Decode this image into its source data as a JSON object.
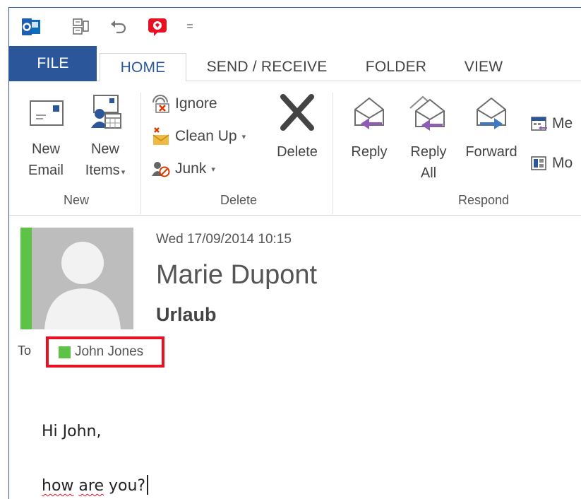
{
  "qat": {
    "icons": [
      "outlook-app-icon",
      "address-book-icon",
      "undo-icon",
      "add-in-icon",
      "customize-qat-icon"
    ],
    "customize_glyph": "="
  },
  "tabs": [
    {
      "label": "FILE"
    },
    {
      "label": "HOME"
    },
    {
      "label": "SEND / RECEIVE"
    },
    {
      "label": "FOLDER"
    },
    {
      "label": "VIEW"
    }
  ],
  "ribbon": {
    "new_group": {
      "label": "New",
      "new_email": {
        "line1": "New",
        "line2": "Email"
      },
      "new_items": {
        "line1": "New",
        "line2": "Items"
      }
    },
    "delete_group": {
      "label": "Delete",
      "ignore": "Ignore",
      "cleanup": "Clean Up",
      "junk": "Junk",
      "delete": "Delete"
    },
    "respond_group": {
      "label": "Respond",
      "reply": "Reply",
      "reply_all": {
        "line1": "Reply",
        "line2": "All"
      },
      "forward": "Forward",
      "meeting": "Me",
      "more": "Mo"
    }
  },
  "message": {
    "date": "Wed 17/09/2014 10:15",
    "sender": "Marie Dupont",
    "subject": "Urlaub",
    "to_label": "To",
    "recipient": "John Jones",
    "body_line1": "Hi John,",
    "body_line2_word1": "how",
    "body_line2_word2": "are",
    "body_line2_word3": "you?"
  },
  "colors": {
    "accent": "#2b579a",
    "flag_green": "#5cc347",
    "highlight_red": "#e81123",
    "reply_purple": "#8e5bb5",
    "forward_blue": "#3e78c2"
  }
}
